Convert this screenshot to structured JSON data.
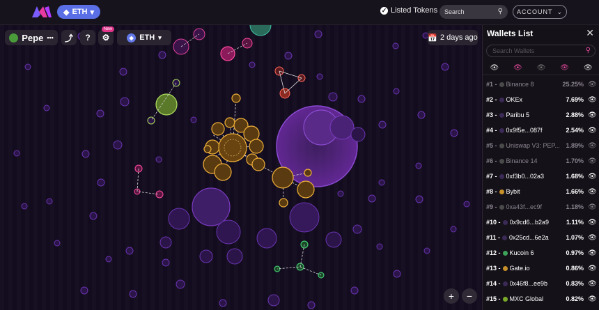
{
  "header": {
    "chain_label": "ETH",
    "listed_tokens": "Listed Tokens",
    "search_placeholder": "Search",
    "account_label": "ACCOUNT"
  },
  "map": {
    "token_name": "Pepe",
    "token_more": "•••",
    "new_badge": "New",
    "network_label": "ETH",
    "time_label": "2 days ago",
    "zoom_in": "+",
    "zoom_out": "−"
  },
  "panel": {
    "title": "Wallets List",
    "search_placeholder": "Search Wallets",
    "close": "✕",
    "rows": [
      {
        "rank": "#1 -",
        "name": "Binance 8",
        "pct": "25.25%",
        "color": "#4a4a4a",
        "dim": true
      },
      {
        "rank": "#2 -",
        "name": "OKEx",
        "pct": "7.69%",
        "color": "#3a2a55",
        "dim": false
      },
      {
        "rank": "#3 -",
        "name": "Paribu 5",
        "pct": "2.88%",
        "color": "#3a2a55",
        "dim": false
      },
      {
        "rank": "#4 -",
        "name": "0x9f5e...087f",
        "pct": "2.54%",
        "color": "#3a2a55",
        "dim": false
      },
      {
        "rank": "#5 -",
        "name": "Uniswap V3: PEP...",
        "pct": "1.89%",
        "color": "#4a4a4a",
        "dim": true
      },
      {
        "rank": "#6 -",
        "name": "Binance 14",
        "pct": "1.70%",
        "color": "#4a4a4a",
        "dim": true
      },
      {
        "rank": "#7 -",
        "name": "0xf3b0...02a3",
        "pct": "1.68%",
        "color": "#3a2a55",
        "dim": false
      },
      {
        "rank": "#8 -",
        "name": "Bybit",
        "pct": "1.66%",
        "color": "#c6902a",
        "dim": false
      },
      {
        "rank": "#9 -",
        "name": "0xa43f...ec9f",
        "pct": "1.18%",
        "color": "#4a4a4a",
        "dim": true
      },
      {
        "rank": "#10 -",
        "name": "0x9cd6...b2a9",
        "pct": "1.11%",
        "color": "#3a2a55",
        "dim": false
      },
      {
        "rank": "#11 -",
        "name": "0x25cd...6e2a",
        "pct": "1.07%",
        "color": "#3a2a55",
        "dim": false
      },
      {
        "rank": "#12 -",
        "name": "Kucoin 6",
        "pct": "0.97%",
        "color": "#3ea35a",
        "dim": false
      },
      {
        "rank": "#13 -",
        "name": "Gate.io",
        "pct": "0.86%",
        "color": "#c6902a",
        "dim": false
      },
      {
        "rank": "#14 -",
        "name": "0x46f8...ee9b",
        "pct": "0.83%",
        "color": "#3a2a55",
        "dim": false
      },
      {
        "rank": "#15 -",
        "name": "MXC Global",
        "pct": "0.82%",
        "color": "#7aaa2a",
        "dim": false
      }
    ]
  }
}
